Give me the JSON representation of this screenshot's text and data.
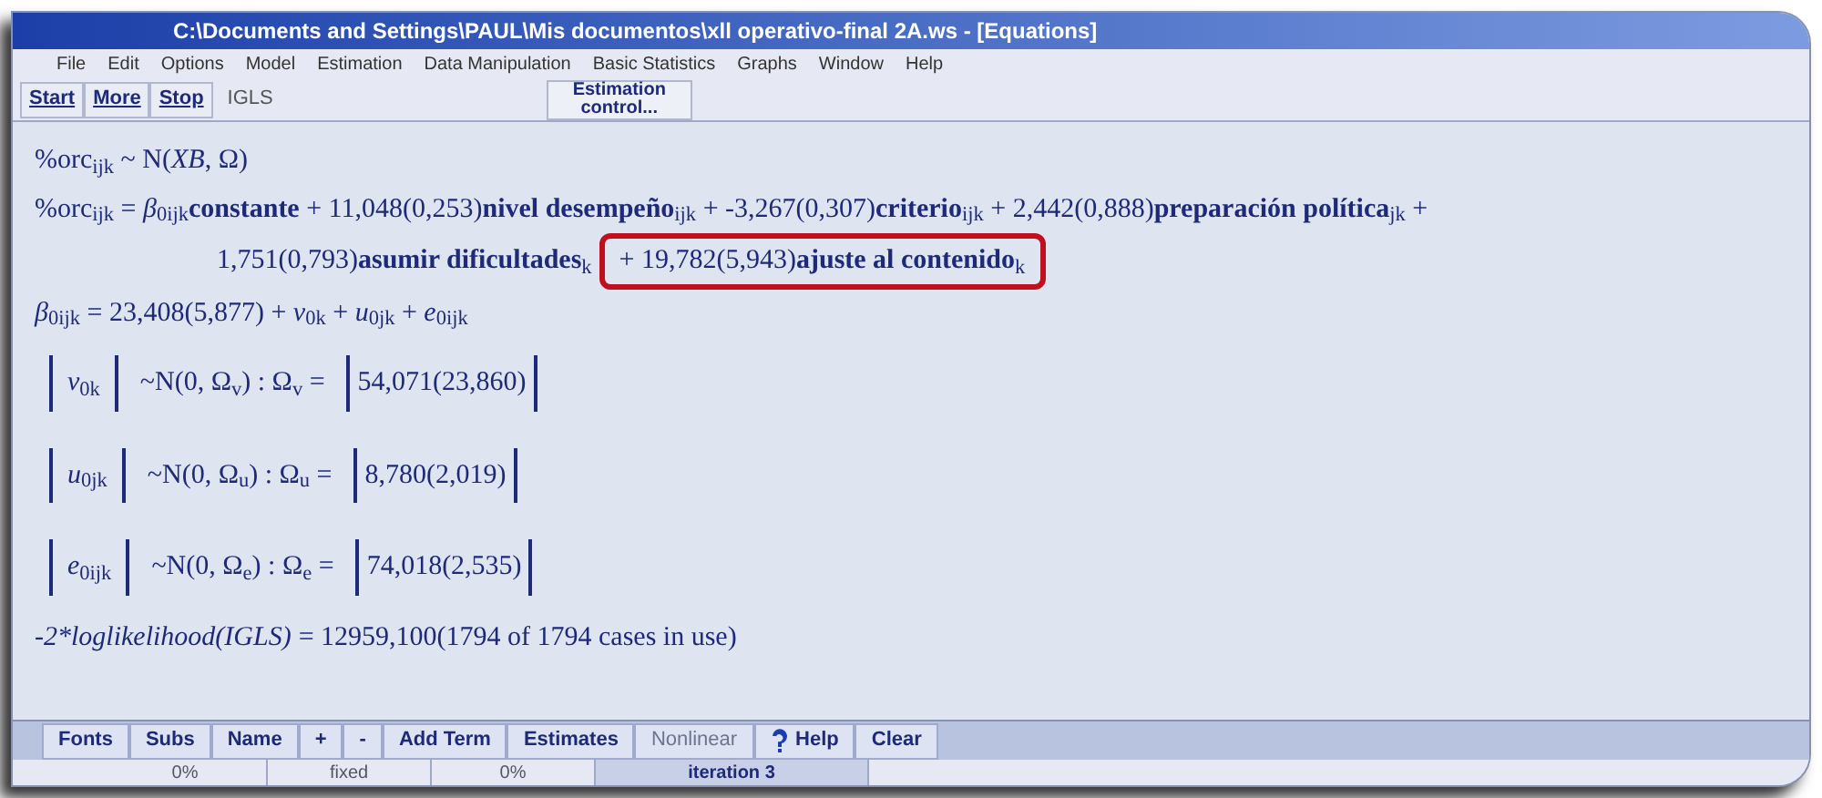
{
  "window": {
    "title": "C:\\Documents and Settings\\PAUL\\Mis documentos\\xll operativo-final 2A.ws - [Equations]"
  },
  "menu": [
    "File",
    "Edit",
    "Options",
    "Model",
    "Estimation",
    "Data Manipulation",
    "Basic Statistics",
    "Graphs",
    "Window",
    "Help"
  ],
  "toolbar": {
    "buttons": [
      "Start",
      "More",
      "Stop"
    ],
    "method": "IGLS",
    "estimation_control": "Estimation control..."
  },
  "equations": [
    {
      "kind": "line",
      "text": "%orc$_{ijk}$ ~ N(*XB*, Ω)"
    },
    {
      "kind": "line",
      "text": "%orc$_{ijk}$ = *β*$_{0ijk}$**constante** + 11,048(0,253)**nivel desempeño**$_{ijk}$ + -3,267(0,307)**criterio**$_{ijk}$ + 2,442(0,888)**preparación política**$_{jk}$ +"
    },
    {
      "kind": "continued",
      "text": "1,751(0,793)**asumir dificultades**$_{k}$",
      "highlighted_text": "+ 19,782(5,943)**ajuste al contenido**$_{k}$"
    },
    {
      "kind": "line",
      "text": "*β*$_{0ijk}$ = 23,408(5,877) + *v*$_{0k}$ + *u*$_{0jk}$ + *e*$_{0ijk}$"
    },
    {
      "kind": "matrix",
      "term": "*v*$_{0k}$",
      "dist": "~N(0, Ω$_{v}$) : Ω$_{v}$ =",
      "value": "54,071(23,860)"
    },
    {
      "kind": "matrix",
      "term": "*u*$_{0jk}$",
      "dist": "~N(0, Ω$_{u}$) : Ω$_{u}$ =",
      "value": "8,780(2,019)"
    },
    {
      "kind": "matrix",
      "term": "*e*$_{0ijk}$",
      "dist": "~N(0, Ω$_{e}$) : Ω$_{e}$ =",
      "value": "74,018(2,535)"
    },
    {
      "kind": "loglik",
      "lhs": "-2*loglikelihood(IGLS)",
      "text": "= 12959,100(1794 of 1794 cases in use)"
    }
  ],
  "bottom_buttons": [
    {
      "label": "Fonts",
      "disabled": false
    },
    {
      "label": "Subs",
      "disabled": false
    },
    {
      "label": "Name",
      "disabled": false
    },
    {
      "label": "+",
      "disabled": false
    },
    {
      "label": "-",
      "disabled": false
    },
    {
      "label": "Add Term",
      "disabled": false
    },
    {
      "label": "Estimates",
      "disabled": false
    },
    {
      "label": "Nonlinear",
      "disabled": true
    },
    {
      "label": "Help",
      "disabled": false,
      "kind": "help"
    },
    {
      "label": "Clear",
      "disabled": false
    }
  ],
  "status_bar": [
    "0%",
    "fixed",
    "0%",
    "iteration  3"
  ]
}
